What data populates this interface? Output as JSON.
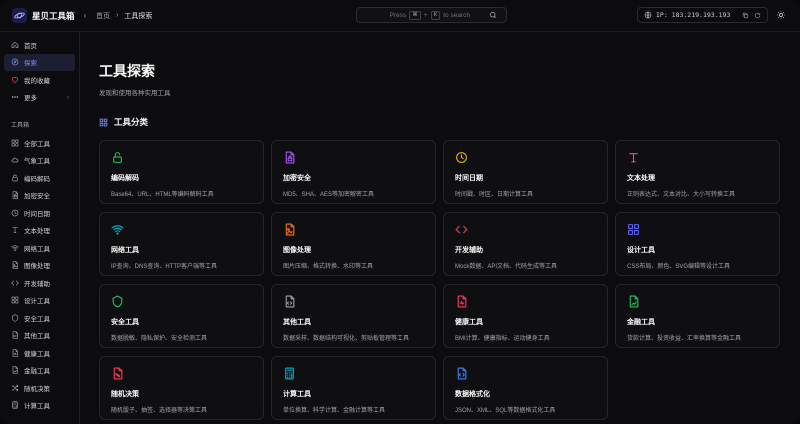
{
  "app": {
    "name": "星贝工具箱"
  },
  "breadcrumb": {
    "home": "首页",
    "current": "工具探索"
  },
  "search": {
    "press": "Press",
    "key1": "⌘",
    "plus": "+",
    "key2": "K",
    "to_search": "to search"
  },
  "ip": {
    "label": "IP: 183.219.193.193"
  },
  "nav": [
    {
      "label": "首页",
      "icon": "home-icon",
      "active": false
    },
    {
      "label": "探索",
      "icon": "compass-icon",
      "active": true
    },
    {
      "label": "我的收藏",
      "icon": "heart-icon",
      "active": false
    },
    {
      "label": "更多",
      "icon": "more-icon",
      "active": false
    }
  ],
  "sidebar": {
    "section_label": "工具箱",
    "tools": [
      {
        "label": "全部工具",
        "icon": "grid-icon"
      },
      {
        "label": "气象工具",
        "icon": "cloud-icon"
      },
      {
        "label": "编码解码",
        "icon": "lock-icon"
      },
      {
        "label": "加密安全",
        "icon": "file-lock-icon"
      },
      {
        "label": "时间日期",
        "icon": "clock-icon"
      },
      {
        "label": "文本处理",
        "icon": "text-icon"
      },
      {
        "label": "网络工具",
        "icon": "wifi-icon"
      },
      {
        "label": "图像处理",
        "icon": "image-icon"
      },
      {
        "label": "开发辅助",
        "icon": "code-icon"
      },
      {
        "label": "设计工具",
        "icon": "layout-icon"
      },
      {
        "label": "安全工具",
        "icon": "shield-icon"
      },
      {
        "label": "其他工具",
        "icon": "file-icon"
      },
      {
        "label": "健康工具",
        "icon": "health-icon"
      },
      {
        "label": "金融工具",
        "icon": "chart-icon"
      },
      {
        "label": "随机决策",
        "icon": "shuffle-icon"
      },
      {
        "label": "计算工具",
        "icon": "calculator-icon"
      }
    ]
  },
  "page": {
    "title": "工具探索",
    "subtitle": "发现和使用各种实用工具",
    "section": "工具分类"
  },
  "categories": [
    {
      "name": "编码解码",
      "desc": "Base64、URL、HTML等编码解码工具",
      "icon": "lock-icon",
      "color": "#22c55e"
    },
    {
      "name": "加密安全",
      "desc": "MD5、SHA、AES等加密解密工具",
      "icon": "file-lock-icon",
      "color": "#a855f7"
    },
    {
      "name": "时间日期",
      "desc": "时间戳、时区、日期计算工具",
      "icon": "clock-icon",
      "color": "#eab308"
    },
    {
      "name": "文本处理",
      "desc": "正则表达式、文本对比、大小写转换工具",
      "icon": "text-icon",
      "color": "#ec4899"
    },
    {
      "name": "网络工具",
      "desc": "IP查询、DNS查询、HTTP客户端等工具",
      "icon": "wifi-icon",
      "color": "#06b6d4"
    },
    {
      "name": "图像处理",
      "desc": "图片压缩、格式转换、水印等工具",
      "icon": "image-icon",
      "color": "#f97316"
    },
    {
      "name": "开发辅助",
      "desc": "Mock数据、API文档、代码生成等工具",
      "icon": "code-icon",
      "color": "#ef4444"
    },
    {
      "name": "设计工具",
      "desc": "CSS布局、颜色、SVG编辑等设计工具",
      "icon": "layout-icon",
      "color": "#6366f1"
    },
    {
      "name": "安全工具",
      "desc": "数据脱敏、隐私保护、安全检测工具",
      "icon": "shield-icon",
      "color": "#22c55e"
    },
    {
      "name": "其他工具",
      "desc": "数据采样、数据结构可视化、剪贴板管理等工具",
      "icon": "file-icon",
      "color": "#a1a1aa"
    },
    {
      "name": "健康工具",
      "desc": "BMI计算、健康指标、运动健身工具",
      "icon": "health-icon",
      "color": "#f43f5e"
    },
    {
      "name": "金融工具",
      "desc": "货款计算、投资收益、汇率换算等金融工具",
      "icon": "chart-icon",
      "color": "#22c55e"
    },
    {
      "name": "随机决策",
      "desc": "随机骰子、抽签、选择器等决策工具",
      "icon": "dice-icon",
      "color": "#f43f5e"
    },
    {
      "name": "计算工具",
      "desc": "单位换算、科学计算、金融计算等工具",
      "icon": "calculator-icon",
      "color": "#06b6d4"
    },
    {
      "name": "数据格式化",
      "desc": "JSON、XML、SQL等数据格式化工具",
      "icon": "code-file-icon",
      "color": "#3b82f6"
    }
  ]
}
